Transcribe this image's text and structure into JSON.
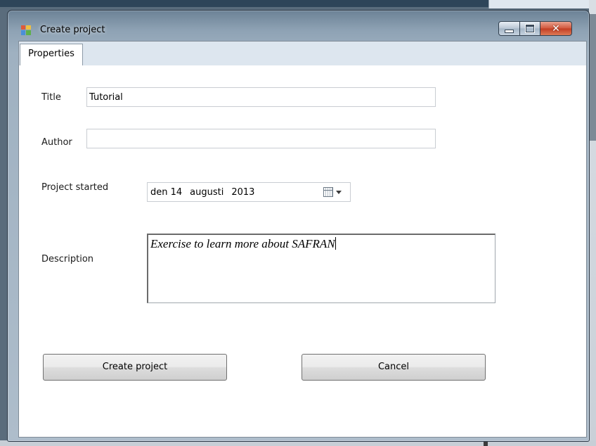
{
  "window": {
    "title": "Create project"
  },
  "tabs": [
    {
      "label": "Properties",
      "selected": true
    }
  ],
  "form": {
    "title_label": "Title",
    "title_value": "Tutorial",
    "author_label": "Author",
    "author_value": "",
    "started_label": "Project started",
    "started_day": "den 14",
    "started_month": "augusti",
    "started_year": "2013",
    "description_label": "Description",
    "description_value": "Exercise to learn more about SAFRAN"
  },
  "buttons": {
    "create_label": "Create project",
    "cancel_label": "Cancel"
  },
  "icons": {
    "app": "app-icon",
    "minimize": "minimize-icon",
    "maximize": "maximize-icon",
    "close": "close-icon",
    "calendar": "calendar-icon",
    "dropdown": "chevron-down-icon"
  },
  "colors": {
    "close_button": "#c23d22",
    "tabstrip": "#dde6ef"
  }
}
